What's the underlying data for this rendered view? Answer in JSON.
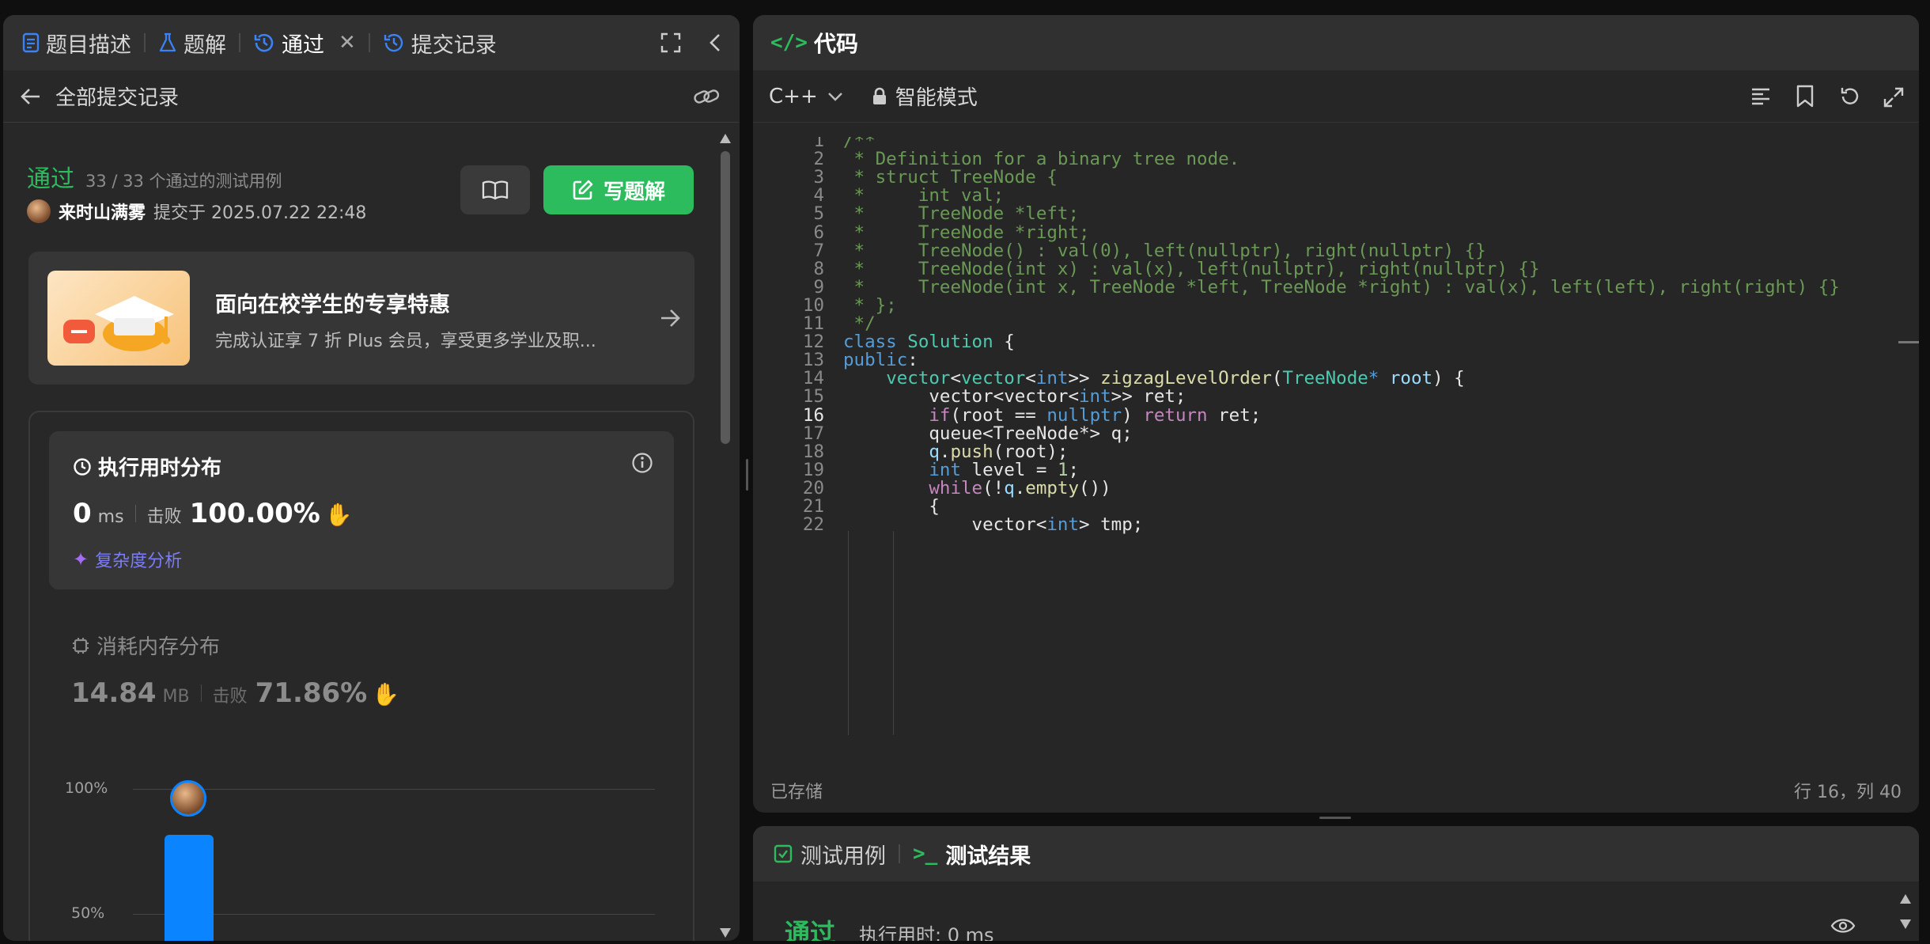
{
  "left_panel": {
    "tabs": [
      {
        "label": "题目描述",
        "icon": "document-icon"
      },
      {
        "label": "题解",
        "icon": "flask-icon"
      },
      {
        "label": "通过",
        "icon": "history-icon"
      },
      {
        "label": "提交记录",
        "icon": "history-icon"
      }
    ],
    "back_label": "全部提交记录",
    "submission": {
      "status": "通过",
      "cases": "33 / 33 个通过的测试用例",
      "user": "来时山满雾",
      "submitted_at": "提交于 2025.07.22 22:48",
      "write_button": "写题解"
    },
    "promo": {
      "title": "面向在校学生的专享特惠",
      "desc": "完成认证享 7 折 Plus 会员，享受更多学业及职..."
    },
    "runtime": {
      "title": "执行用时分布",
      "value": "0",
      "unit": "ms",
      "beats_label": "击败",
      "beats": "100.00%",
      "complexity_link": "复杂度分析"
    },
    "memory": {
      "title": "消耗内存分布",
      "value": "14.84",
      "unit": "MB",
      "beats_label": "击败",
      "beats": "71.86%"
    },
    "chart": {
      "y_ticks": [
        "100%",
        "50%"
      ],
      "bar_fraction": 0.58
    }
  },
  "code_panel": {
    "title": "代码",
    "language": "C++",
    "mode": "智能模式",
    "saved": "已存储",
    "cursor": "行 16，列 40",
    "current_line": 16
  },
  "bottom_panel": {
    "tabs": [
      "测试用例",
      "测试结果"
    ],
    "status": "通过",
    "runtime": "执行用时: 0 ms"
  },
  "colors": {
    "accent_green": "#2cbb5d",
    "accent_blue": "#3b82f6",
    "bar_blue": "#0a84ff"
  }
}
